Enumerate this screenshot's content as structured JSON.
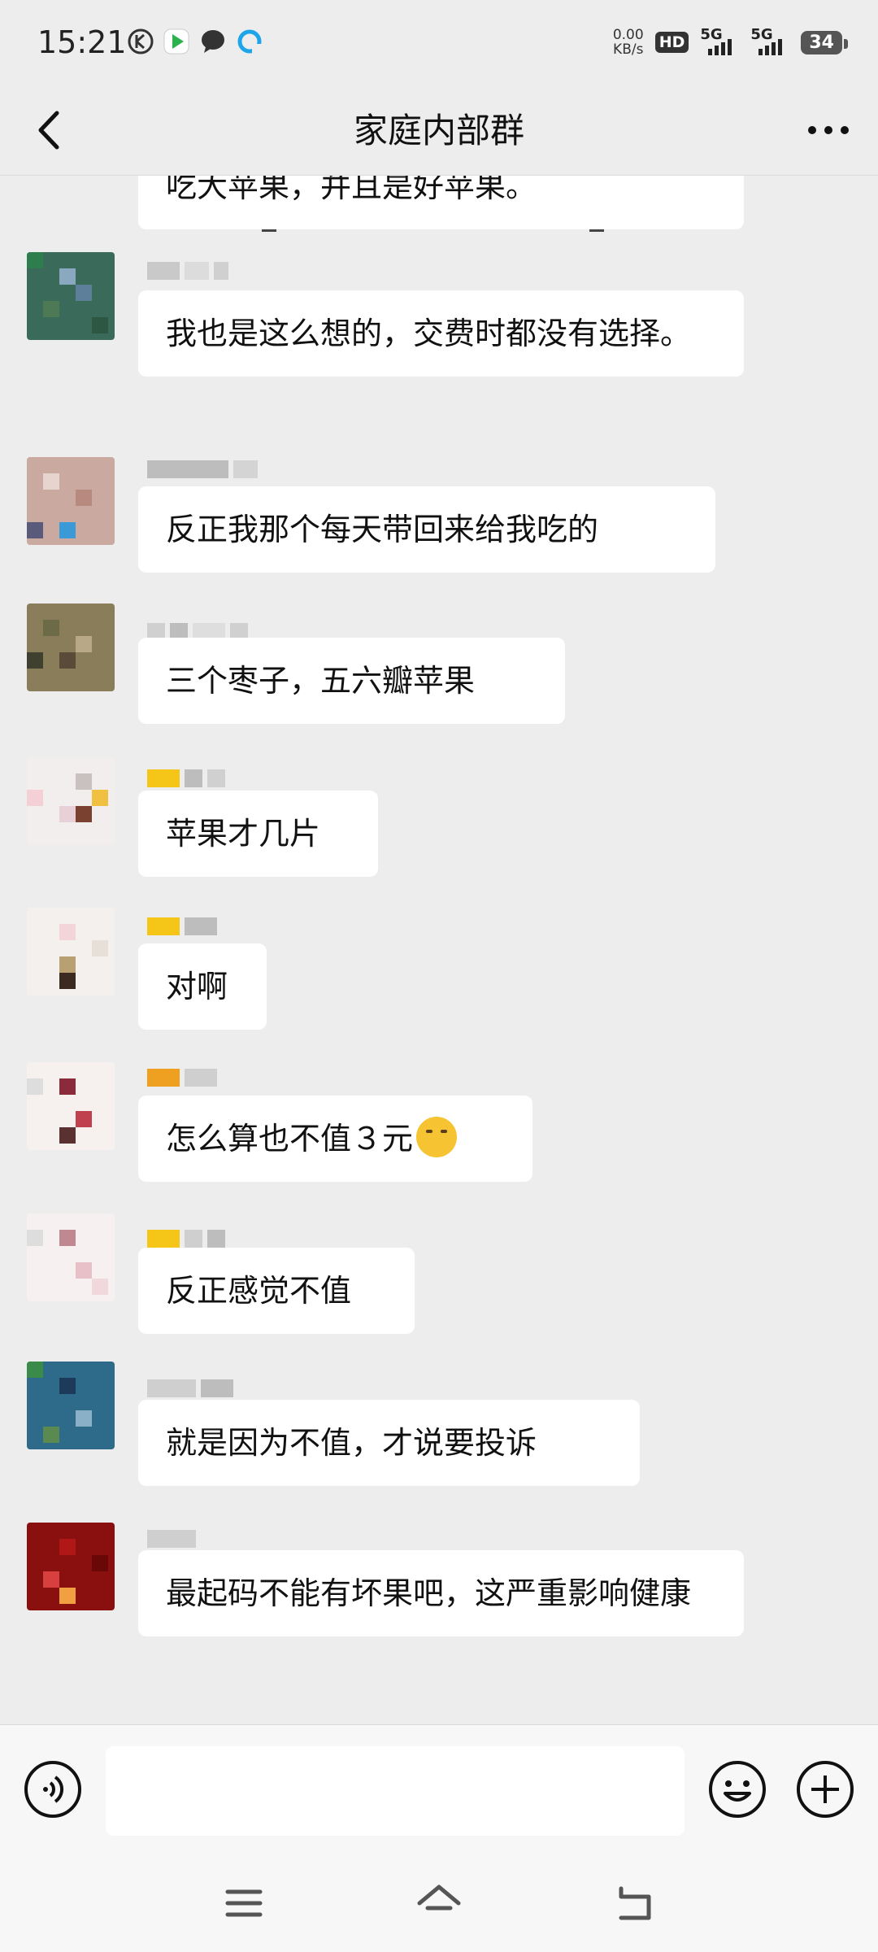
{
  "status": {
    "time": "15:21",
    "speed_value": "0.00",
    "speed_unit": "KB/s",
    "hd": "HD",
    "sim1": "5G",
    "sim2": "5G",
    "battery": "34"
  },
  "header": {
    "title": "家庭内部群"
  },
  "messages": [
    {
      "text": "吃大苹果，并且是好苹果。"
    },
    {
      "text": "我也是这么想的，交费时都没有选择。"
    },
    {
      "text": "反正我那个每天带回来给我吃的"
    },
    {
      "text": "三个枣子，五六瓣苹果"
    },
    {
      "text": "苹果才几片"
    },
    {
      "text": "对啊"
    },
    {
      "text": "怎么算也不值３元"
    },
    {
      "text": "反正感觉不值"
    },
    {
      "text": "就是因为不值，才说要投诉"
    },
    {
      "text": "最起码不能有坏果吧，这严重影响健康"
    }
  ],
  "colors": {
    "background": "#ededed",
    "bubble": "#ffffff",
    "input_bar": "#f7f7f7"
  },
  "icons": {
    "back": "back-arrow-icon",
    "more": "more-dots-icon",
    "voice": "voice-icon",
    "emoji": "emoji-icon",
    "plus": "plus-icon",
    "menu": "menu-icon",
    "home": "home-icon",
    "return": "return-icon"
  }
}
